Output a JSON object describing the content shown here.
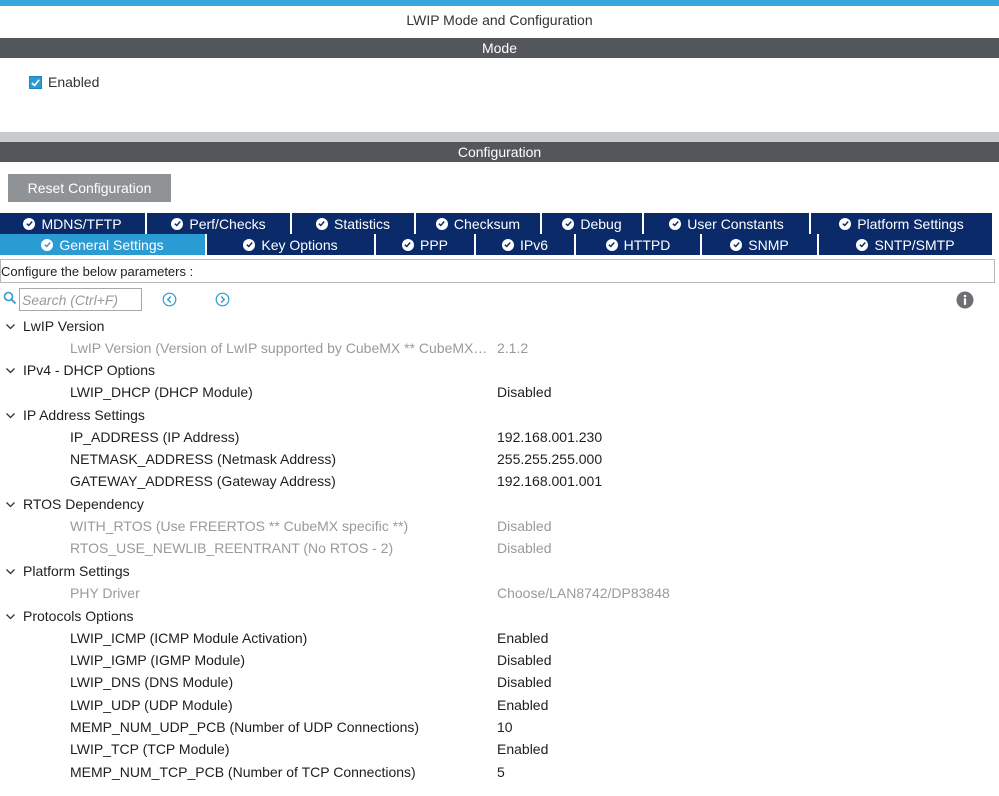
{
  "window": {
    "title": "LWIP Mode and Configuration"
  },
  "mode": {
    "header": "Mode",
    "enabled_label": "Enabled",
    "enabled_checked": true
  },
  "configuration": {
    "header": "Configuration",
    "reset_label": "Reset Configuration"
  },
  "tabs_row1": [
    {
      "label": "MDNS/TFTP"
    },
    {
      "label": "Perf/Checks"
    },
    {
      "label": "Statistics"
    },
    {
      "label": "Checksum"
    },
    {
      "label": "Debug"
    },
    {
      "label": "User Constants"
    },
    {
      "label": "Platform Settings"
    }
  ],
  "tabs_row2": [
    {
      "label": "General Settings",
      "active": true
    },
    {
      "label": "Key Options"
    },
    {
      "label": "PPP"
    },
    {
      "label": "IPv6"
    },
    {
      "label": "HTTPD"
    },
    {
      "label": "SNMP"
    },
    {
      "label": "SNTP/SMTP"
    }
  ],
  "description": "Configure the below parameters :",
  "search": {
    "placeholder": "Search (Ctrl+F)"
  },
  "colors": {
    "accent": "#39a7dd",
    "section_header": "#53565a",
    "tab_inactive": "#0a2a6a",
    "tab_active": "#2b9bd3",
    "readonly_text": "#9a9a9a"
  },
  "groups": {
    "lwip_version": {
      "label": "LwIP Version",
      "params": [
        {
          "name": "LwIP Version (Version of LwIP supported by CubeMX ** CubeMX specific **)",
          "value": "2.1.2",
          "readonly": true
        }
      ]
    },
    "ipv4_dhcp": {
      "label": "IPv4 - DHCP Options",
      "params": [
        {
          "name": "LWIP_DHCP (DHCP Module)",
          "value": "Disabled"
        }
      ]
    },
    "ip_address": {
      "label": "IP Address Settings",
      "params": [
        {
          "name": "IP_ADDRESS (IP Address)",
          "value": "192.168.001.230"
        },
        {
          "name": "NETMASK_ADDRESS (Netmask Address)",
          "value": "255.255.255.000"
        },
        {
          "name": "GATEWAY_ADDRESS (Gateway Address)",
          "value": "192.168.001.001"
        }
      ]
    },
    "rtos": {
      "label": "RTOS Dependency",
      "params": [
        {
          "name": "WITH_RTOS (Use FREERTOS ** CubeMX specific **)",
          "value": "Disabled",
          "readonly": true
        },
        {
          "name": "RTOS_USE_NEWLIB_REENTRANT (No RTOS - 2)",
          "value": "Disabled",
          "readonly": true
        }
      ]
    },
    "platform": {
      "label": "Platform Settings",
      "params": [
        {
          "name": "PHY Driver",
          "value": "Choose/LAN8742/DP83848",
          "readonly": true
        }
      ]
    },
    "protocols": {
      "label": "Protocols Options",
      "params": [
        {
          "name": "LWIP_ICMP (ICMP Module Activation)",
          "value": "Enabled"
        },
        {
          "name": "LWIP_IGMP (IGMP Module)",
          "value": "Disabled"
        },
        {
          "name": "LWIP_DNS (DNS Module)",
          "value": "Disabled"
        },
        {
          "name": "LWIP_UDP (UDP Module)",
          "value": "Enabled"
        },
        {
          "name": "MEMP_NUM_UDP_PCB (Number of UDP Connections)",
          "value": "10"
        },
        {
          "name": "LWIP_TCP (TCP Module)",
          "value": "Enabled"
        },
        {
          "name": "MEMP_NUM_TCP_PCB (Number of TCP Connections)",
          "value": "5"
        }
      ]
    }
  }
}
